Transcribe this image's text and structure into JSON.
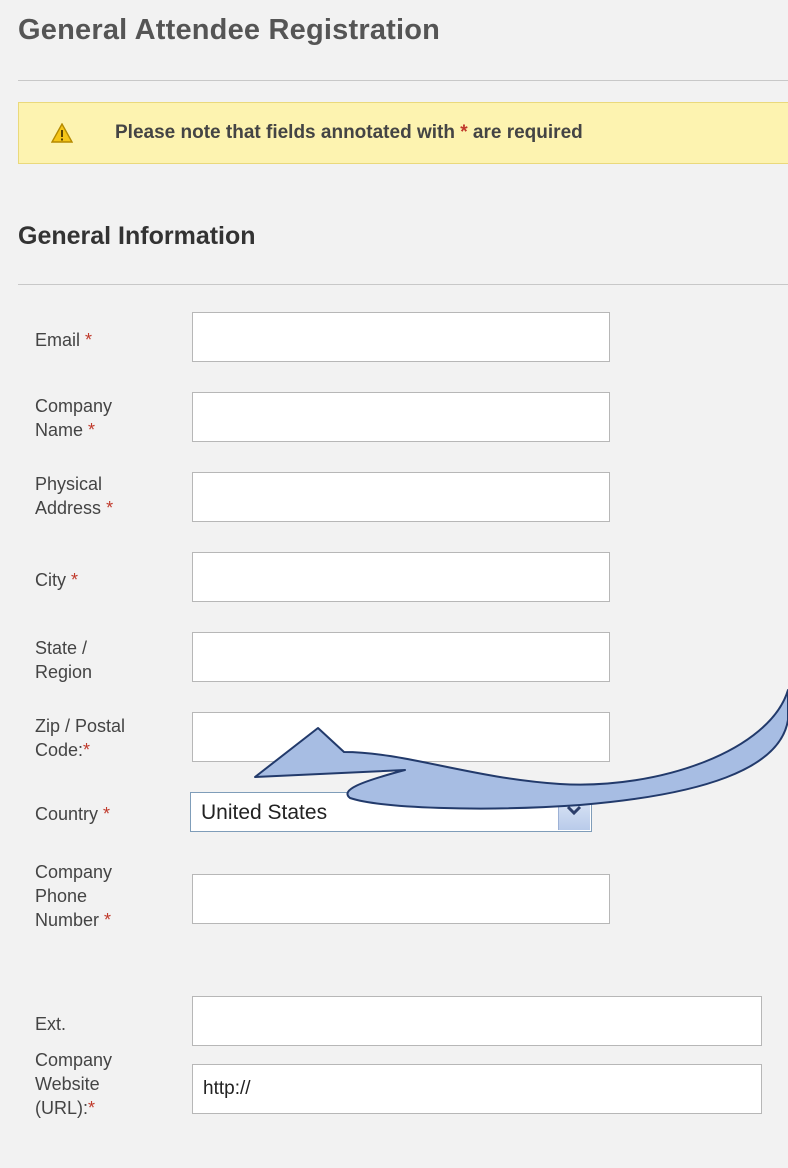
{
  "page": {
    "title": "General Attendee Registration"
  },
  "notice": {
    "icon": "warning-icon",
    "text_before": "Please note that fields annotated with ",
    "star": "*",
    "text_after": " are required"
  },
  "section": {
    "title": "General Information"
  },
  "fields": {
    "email": {
      "label": "Email",
      "req": "*",
      "value": ""
    },
    "company_name": {
      "label_line1": "Company",
      "label_line2": "Name",
      "req": "*",
      "value": ""
    },
    "address": {
      "label_line1": "Physical",
      "label_line2": "Address",
      "req": "*",
      "value": ""
    },
    "city": {
      "label": "City",
      "req": "*",
      "value": ""
    },
    "state": {
      "label_line1": "State /",
      "label_line2": "Region",
      "value": ""
    },
    "zip": {
      "label_line1": "Zip / Postal",
      "label_line2": "Code:",
      "req": "*",
      "value": ""
    },
    "country": {
      "label": "Country",
      "req": "*",
      "value": "United States"
    },
    "phone": {
      "label_line1": "Company",
      "label_line2": "Phone",
      "label_line3": "Number",
      "req": "*",
      "value": ""
    },
    "ext": {
      "label": "Ext.",
      "value": ""
    },
    "website": {
      "label_line1": "Company",
      "label_line2": "Website",
      "label_line3": "(URL):",
      "req": "*",
      "value": "http://"
    }
  },
  "colors": {
    "background": "#f2f2f2",
    "notice_bg": "#fdf3b0",
    "required": "#c0392b",
    "annotation_arrow": "#9fb6dc"
  }
}
